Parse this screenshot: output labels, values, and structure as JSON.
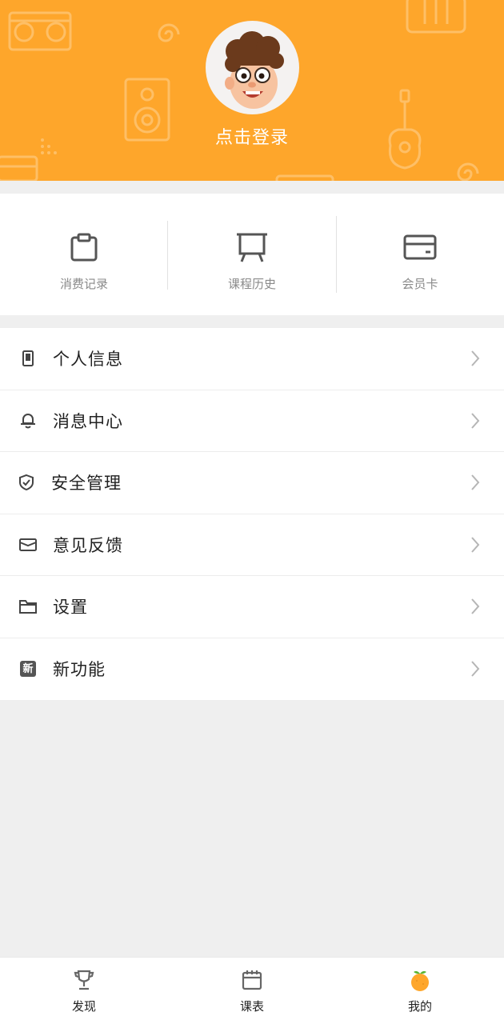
{
  "colors": {
    "brand": "#fea62b",
    "background": "#efefef",
    "chevron": "#b5b5b5"
  },
  "header": {
    "login_label": "点击登录",
    "avatar_icon": "cartoon-avatar"
  },
  "quick_actions": [
    {
      "label": "消费记录",
      "icon": "clipboard-icon"
    },
    {
      "label": "课程历史",
      "icon": "presentation-board-icon"
    },
    {
      "label": "会员卡",
      "icon": "card-icon"
    }
  ],
  "menu": [
    {
      "label": "个人信息",
      "icon": "phone-icon"
    },
    {
      "label": "消息中心",
      "icon": "bell-icon"
    },
    {
      "label": "安全管理",
      "icon": "shield-icon"
    },
    {
      "label": "意见反馈",
      "icon": "envelope-icon"
    },
    {
      "label": "设置",
      "icon": "folder-icon"
    },
    {
      "label": "新功能",
      "icon": "new-badge-icon",
      "badge_text": "新"
    }
  ],
  "tabbar": [
    {
      "label": "发现",
      "icon": "trophy-icon",
      "active": false
    },
    {
      "label": "课表",
      "icon": "calendar-icon",
      "active": false
    },
    {
      "label": "我的",
      "icon": "orange-fruit-icon",
      "active": true
    }
  ]
}
